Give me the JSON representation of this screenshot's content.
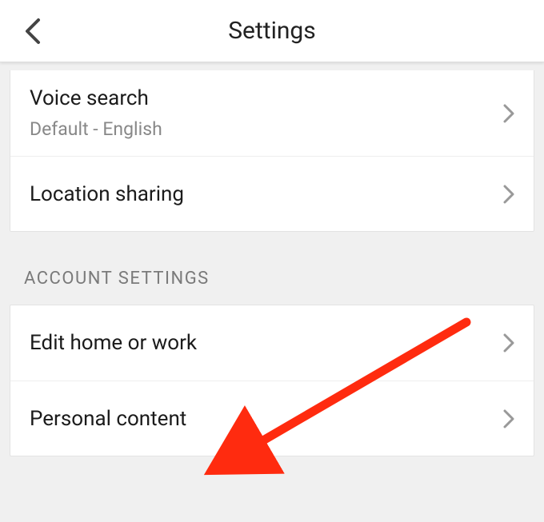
{
  "header": {
    "title": "Settings"
  },
  "group1": {
    "rows": [
      {
        "title": "Voice search",
        "subtitle": "Default - English"
      },
      {
        "title": "Location sharing"
      }
    ]
  },
  "section_label": "ACCOUNT SETTINGS",
  "group2": {
    "rows": [
      {
        "title": "Edit home or work"
      },
      {
        "title": "Personal content"
      }
    ]
  }
}
